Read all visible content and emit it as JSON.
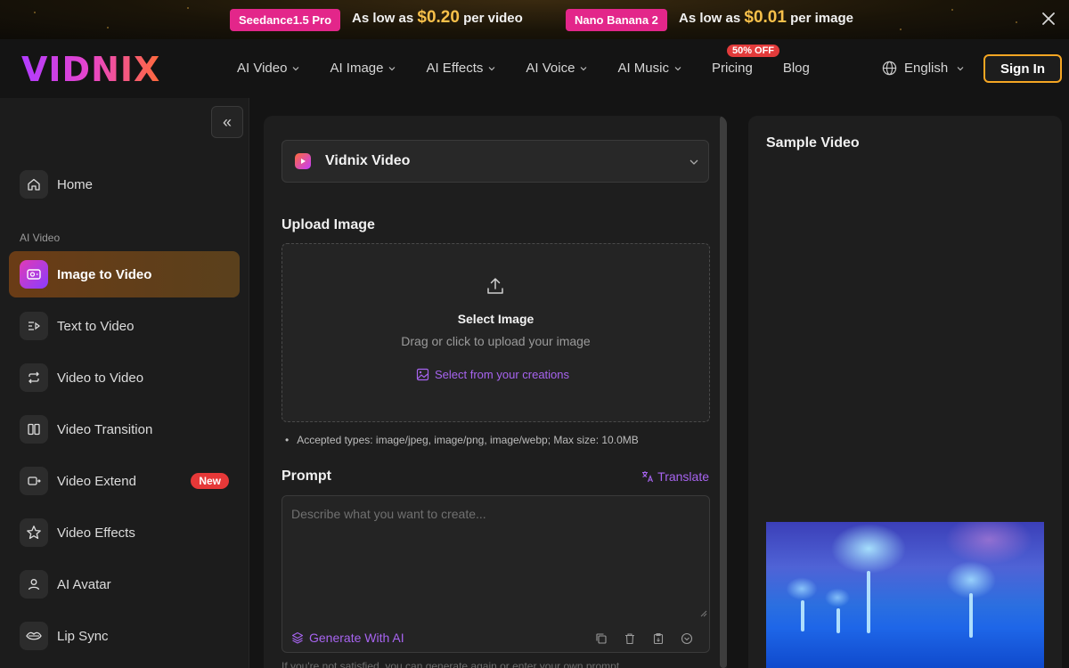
{
  "promo": {
    "items": [
      {
        "tag": "Seedance1.5 Pro",
        "prefix": "As low as",
        "price": "$0.20",
        "suffix": "per video"
      },
      {
        "tag": "Nano Banana 2",
        "prefix": "As low as",
        "price": "$0.01",
        "suffix": "per image"
      }
    ],
    "tag_color": "#e3268a",
    "price_color": "#f7c04a"
  },
  "header": {
    "logo": "VIDNIX",
    "nav": [
      {
        "label": "AI Video",
        "icon": "chevron-down-icon"
      },
      {
        "label": "AI Image",
        "icon": "chevron-down-icon"
      },
      {
        "label": "AI Effects",
        "icon": "chevron-down-icon"
      },
      {
        "label": "AI Voice",
        "icon": "chevron-down-icon"
      },
      {
        "label": "AI Music",
        "icon": "chevron-down-icon"
      },
      {
        "label": "Pricing",
        "badge": "50% OFF"
      },
      {
        "label": "Blog"
      }
    ],
    "language": "English",
    "sign_in": "Sign In",
    "accent": "#f5a623"
  },
  "sidebar": {
    "collapse_glyph": "«",
    "home": "Home",
    "section": "AI Video",
    "items": [
      {
        "label": "Image to Video",
        "icon": "image-video-icon",
        "active": true
      },
      {
        "label": "Text to Video",
        "icon": "text-video-icon"
      },
      {
        "label": "Video to Video",
        "icon": "repeat-icon"
      },
      {
        "label": "Video Transition",
        "icon": "transition-icon"
      },
      {
        "label": "Video Extend",
        "icon": "video-extend-icon",
        "badge": "New"
      },
      {
        "label": "Video Effects",
        "icon": "star-icon"
      },
      {
        "label": "AI Avatar",
        "icon": "user-icon"
      },
      {
        "label": "Lip Sync",
        "icon": "lips-icon"
      }
    ]
  },
  "main": {
    "model": "Vidnix Video",
    "upload": {
      "title": "Upload Image",
      "select": "Select Image",
      "hint": "Drag or click to upload your image",
      "link": "Select from your creations",
      "accepted": "Accepted types: image/jpeg, image/png, image/webp; Max size: 10.0MB"
    },
    "prompt": {
      "title": "Prompt",
      "translate": "Translate",
      "placeholder": "Describe what you want to create...",
      "generate": "Generate With AI",
      "footer": "If you're not satisfied, you can generate again or enter your own prompt."
    },
    "link_color": "#a764f0"
  },
  "right": {
    "title": "Sample Video"
  }
}
